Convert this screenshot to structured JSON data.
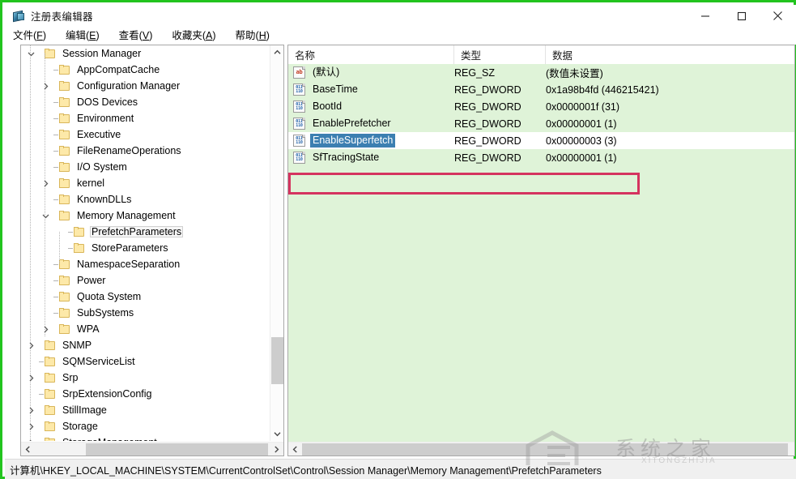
{
  "window": {
    "title": "注册表编辑器",
    "icon": "registry-editor-icon",
    "minimize_label": "—",
    "maximize_label": "□",
    "close_label": "✕",
    "frame_color": "#22c41e"
  },
  "menu": {
    "items": [
      {
        "label": "文件(F)",
        "text": "文件(",
        "accel": "F",
        "tail": ")"
      },
      {
        "label": "编辑(E)",
        "text": "编辑(",
        "accel": "E",
        "tail": ")"
      },
      {
        "label": "查看(V)",
        "text": "查看(",
        "accel": "V",
        "tail": ")"
      },
      {
        "label": "收藏夹(A)",
        "text": "收藏夹(",
        "accel": "A",
        "tail": ")"
      },
      {
        "label": "帮助(H)",
        "text": "帮助(",
        "accel": "H",
        "tail": ")"
      }
    ]
  },
  "tree": {
    "items": [
      {
        "label": "Session Manager",
        "depth": 1,
        "twisty": "expanded",
        "selected": false
      },
      {
        "label": "AppCompatCache",
        "depth": 2,
        "twisty": "none",
        "selected": false
      },
      {
        "label": "Configuration Manager",
        "depth": 2,
        "twisty": "collapsed",
        "selected": false
      },
      {
        "label": "DOS Devices",
        "depth": 2,
        "twisty": "none",
        "selected": false
      },
      {
        "label": "Environment",
        "depth": 2,
        "twisty": "none",
        "selected": false
      },
      {
        "label": "Executive",
        "depth": 2,
        "twisty": "none",
        "selected": false
      },
      {
        "label": "FileRenameOperations",
        "depth": 2,
        "twisty": "none",
        "selected": false
      },
      {
        "label": "I/O System",
        "depth": 2,
        "twisty": "none",
        "selected": false
      },
      {
        "label": "kernel",
        "depth": 2,
        "twisty": "collapsed",
        "selected": false
      },
      {
        "label": "KnownDLLs",
        "depth": 2,
        "twisty": "none",
        "selected": false
      },
      {
        "label": "Memory Management",
        "depth": 2,
        "twisty": "expanded",
        "selected": false
      },
      {
        "label": "PrefetchParameters",
        "depth": 3,
        "twisty": "none",
        "selected": true
      },
      {
        "label": "StoreParameters",
        "depth": 3,
        "twisty": "none",
        "selected": false
      },
      {
        "label": "NamespaceSeparation",
        "depth": 2,
        "twisty": "none",
        "selected": false
      },
      {
        "label": "Power",
        "depth": 2,
        "twisty": "none",
        "selected": false
      },
      {
        "label": "Quota System",
        "depth": 2,
        "twisty": "none",
        "selected": false
      },
      {
        "label": "SubSystems",
        "depth": 2,
        "twisty": "none",
        "selected": false
      },
      {
        "label": "WPA",
        "depth": 2,
        "twisty": "collapsed",
        "selected": false
      },
      {
        "label": "SNMP",
        "depth": 1,
        "twisty": "collapsed",
        "selected": false
      },
      {
        "label": "SQMServiceList",
        "depth": 1,
        "twisty": "none",
        "selected": false
      },
      {
        "label": "Srp",
        "depth": 1,
        "twisty": "collapsed",
        "selected": false
      },
      {
        "label": "SrpExtensionConfig",
        "depth": 1,
        "twisty": "none",
        "selected": false
      },
      {
        "label": "StillImage",
        "depth": 1,
        "twisty": "collapsed",
        "selected": false
      },
      {
        "label": "Storage",
        "depth": 1,
        "twisty": "collapsed",
        "selected": false
      },
      {
        "label": "StorageManagement",
        "depth": 1,
        "twisty": "collapsed",
        "selected": false
      }
    ]
  },
  "list": {
    "columns": [
      {
        "key": "name",
        "label": "名称"
      },
      {
        "key": "type",
        "label": "类型"
      },
      {
        "key": "data",
        "label": "数据"
      }
    ],
    "rows": [
      {
        "name": "(默认)",
        "type": "REG_SZ",
        "data": "(数值未设置)",
        "icon": "string-value-icon",
        "selected": false
      },
      {
        "name": "BaseTime",
        "type": "REG_DWORD",
        "data": "0x1a98b4fd (446215421)",
        "icon": "dword-value-icon",
        "selected": false
      },
      {
        "name": "BootId",
        "type": "REG_DWORD",
        "data": "0x0000001f (31)",
        "icon": "dword-value-icon",
        "selected": false
      },
      {
        "name": "EnablePrefetcher",
        "type": "REG_DWORD",
        "data": "0x00000001 (1)",
        "icon": "dword-value-icon",
        "selected": false
      },
      {
        "name": "EnableSuperfetch",
        "type": "REG_DWORD",
        "data": "0x00000003 (3)",
        "icon": "dword-value-icon",
        "selected": true
      },
      {
        "name": "SfTracingState",
        "type": "REG_DWORD",
        "data": "0x00000001 (1)",
        "icon": "dword-value-icon",
        "selected": false
      }
    ],
    "background_color": "#dff3d8",
    "selection_color": "#3c7fb1"
  },
  "annotation": {
    "shape": "rectangle",
    "color": "#d5335f",
    "targets_row": "EnableSuperfetch"
  },
  "status": {
    "path": "计算机\\HKEY_LOCAL_MACHINE\\SYSTEM\\CurrentControlSet\\Control\\Session Manager\\Memory Management\\PrefetchParameters"
  },
  "watermark": {
    "chinese": "系统之家",
    "english": "XITONGZHIJIA"
  },
  "scrollbars": {
    "tree_up_arrow": "∧",
    "tree_down_arrow": "∨",
    "left_arrow": "‹",
    "right_arrow": "›"
  }
}
